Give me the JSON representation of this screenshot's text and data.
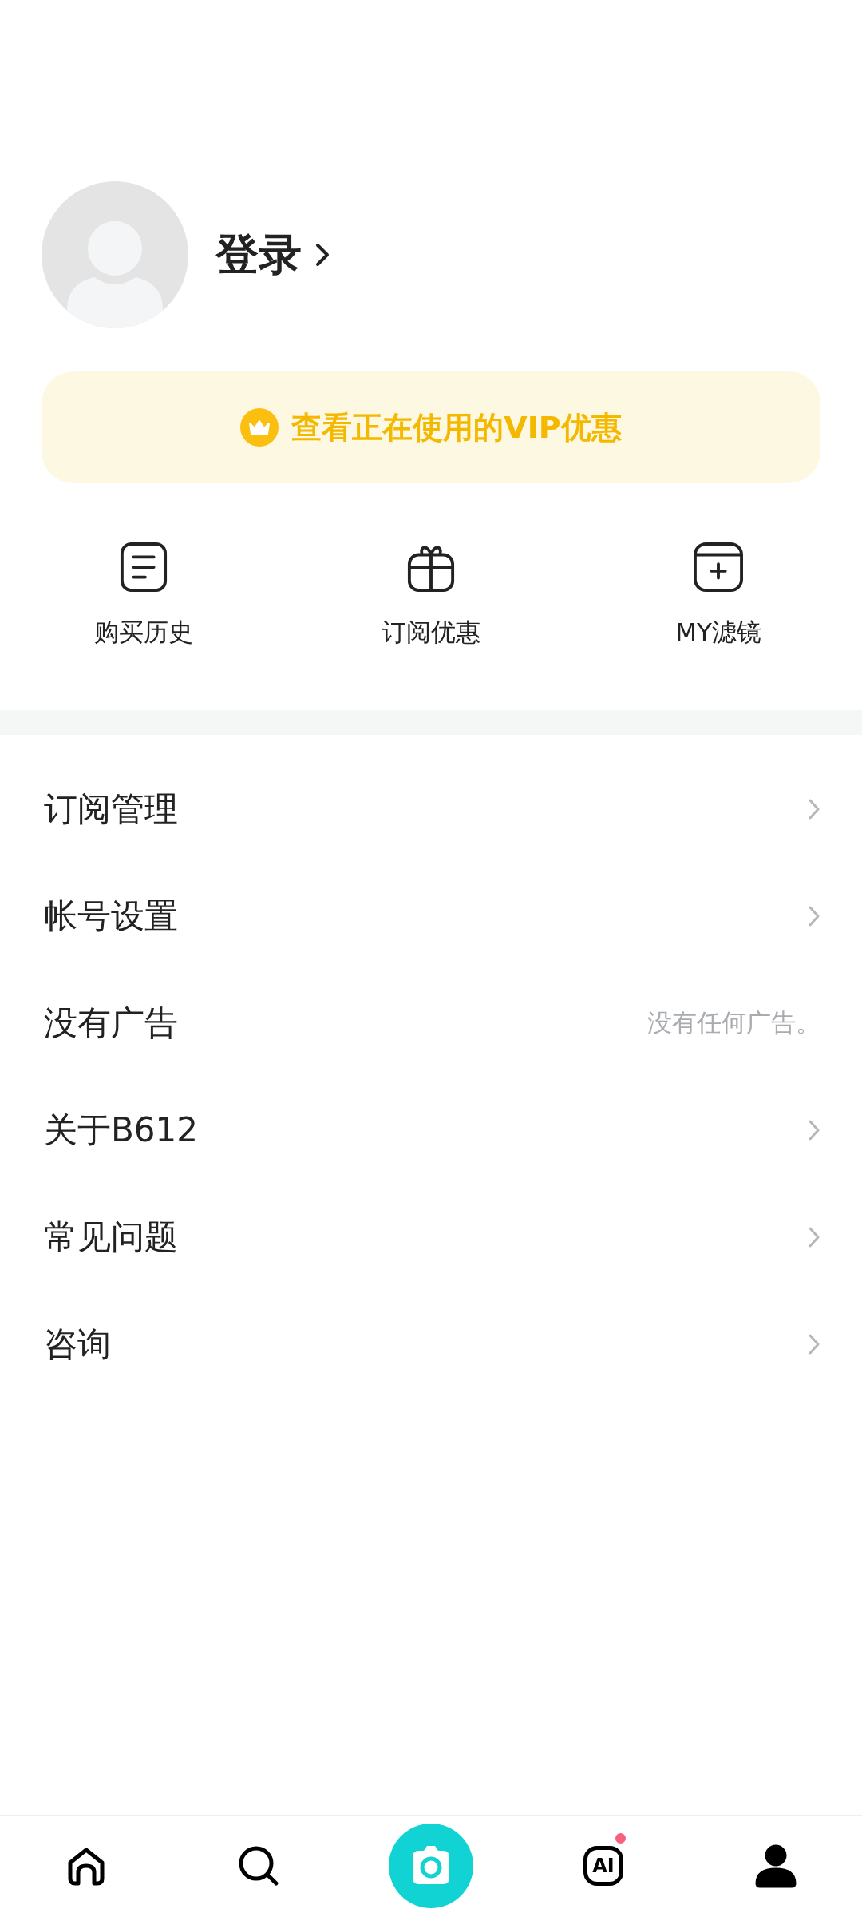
{
  "profile": {
    "login_label": "登录"
  },
  "vip_banner": {
    "text": "查看正在使用的VIP优惠"
  },
  "shortcuts": [
    {
      "kind": "receipt",
      "label": "购买历史"
    },
    {
      "kind": "gift",
      "label": "订阅优惠"
    },
    {
      "kind": "filter",
      "label": "MY滤镜"
    }
  ],
  "menu": [
    {
      "kind": "link",
      "label": "订阅管理"
    },
    {
      "kind": "link",
      "label": "帐号设置"
    },
    {
      "kind": "note",
      "label": "没有广告",
      "value": "没有任何广告。"
    },
    {
      "kind": "link",
      "label": "关于B612"
    },
    {
      "kind": "link",
      "label": "常见问题"
    },
    {
      "kind": "link",
      "label": "咨询"
    }
  ],
  "bottom_nav": [
    {
      "kind": "home",
      "selected": false,
      "badge": false
    },
    {
      "kind": "search",
      "selected": false,
      "badge": false
    },
    {
      "kind": "camera",
      "selected": false,
      "badge": false
    },
    {
      "kind": "ai",
      "text": "AI",
      "selected": false,
      "badge": true
    },
    {
      "kind": "profile",
      "selected": true,
      "badge": false
    }
  ]
}
